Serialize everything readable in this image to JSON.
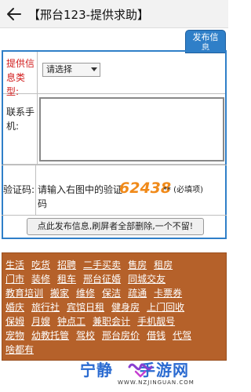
{
  "header": {
    "title": "【邢台123-提供求助】"
  },
  "post_tab": {
    "line1": "发布信",
    "line2": "息"
  },
  "form": {
    "type_label": "提供信息类型:",
    "type_select_value": "请选择",
    "contact_label": "联系手机:",
    "contact_value": "",
    "captcha_label": "验证码:",
    "captcha_prompt": "请输入右图中的验证码",
    "captcha_code": "62438",
    "captcha_suffix": "** (必填项)",
    "submit_label": "点此发布信息,刷屏者全部删除,一个不留!"
  },
  "categories": [
    [
      "生活",
      "吃货",
      "招聘",
      "二手买卖",
      "售房",
      "租房"
    ],
    [
      "门市",
      "装修",
      "租车",
      "邢台征婚",
      "同城交友"
    ],
    [
      "教育培训",
      "搬家",
      "维修",
      "保洁",
      "疏通",
      "卡票券"
    ],
    [
      "婚庆",
      "旅行社",
      "宾馆日租",
      "健身房",
      "上门回收"
    ],
    [
      "保姆",
      "月嫂",
      "钟点工",
      "兼职会计",
      "手机靓号"
    ],
    [
      "宠物",
      "幼教托管",
      "驾校",
      "邢台房价",
      "借钱",
      "代驾"
    ],
    [
      "啥都有"
    ]
  ],
  "watermark": {
    "text_left": "宁静",
    "text_right": "手游网",
    "url": "WWW.NZJINGUAN.COM"
  },
  "colors": {
    "accent_blue": "#2f7fc8",
    "category_bg": "#b5612a",
    "required_red": "#d21e1e",
    "captcha_orange": "#f08a1a"
  },
  "icons": {
    "back": "back-arrow-icon",
    "select": "chevron-down-icon"
  }
}
